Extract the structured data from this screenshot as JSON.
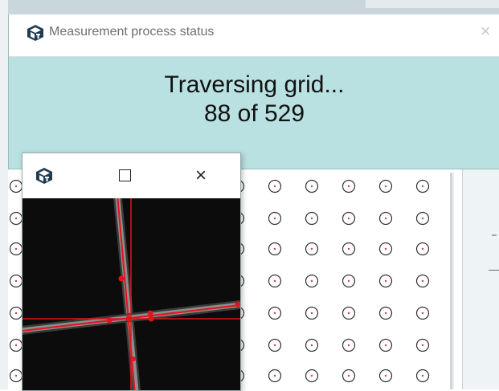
{
  "status_dialog": {
    "title": "Measurement process status",
    "close_glyph": "×",
    "line1": "Traversing grid...",
    "line2": "88 of 529",
    "progress": {
      "current": 88,
      "total": 529
    }
  },
  "camera_window": {
    "maximize_glyph": "□",
    "close_glyph": "×"
  },
  "icons": {
    "app": "cube-logo-icon",
    "grid_point": "target-circle-icon"
  },
  "colors": {
    "dialog_bg": "#b9e1e1",
    "crosshair": "#e0141c",
    "line_gray": "#8e8e8e",
    "grid_point": "#333333",
    "grid_center": "#d04040"
  }
}
